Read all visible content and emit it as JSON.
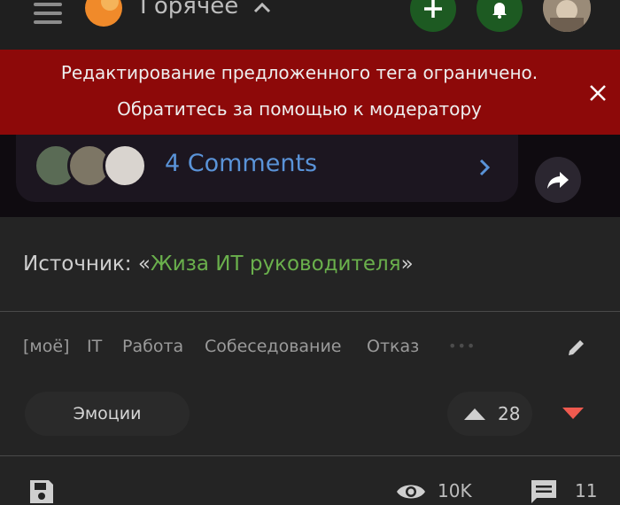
{
  "header": {
    "feed_title": "Горячее",
    "icons": [
      "menu-icon",
      "logo-icon",
      "chevron-up-icon",
      "plus-icon",
      "bell-icon",
      "avatar"
    ]
  },
  "banner": {
    "line1": "Редактирование предложенного тега ограничено.",
    "line2": "Обратитесь за помощью к модератору",
    "color": "#8d0909"
  },
  "embed": {
    "comments_label": "4 Comments",
    "link_color": "#5a93d8"
  },
  "post": {
    "source_prefix": "Источник: «",
    "source_link": "Жиза ИТ руководителя",
    "source_suffix": "»",
    "link_color": "#6ab04c",
    "tags": [
      "[моё]",
      "IT",
      "Работа",
      "Собеседование",
      "Отказ"
    ],
    "more_tags": "•••",
    "emotions_label": "Эмоции",
    "rating": "28",
    "views": "10K",
    "comments_count": "11"
  }
}
